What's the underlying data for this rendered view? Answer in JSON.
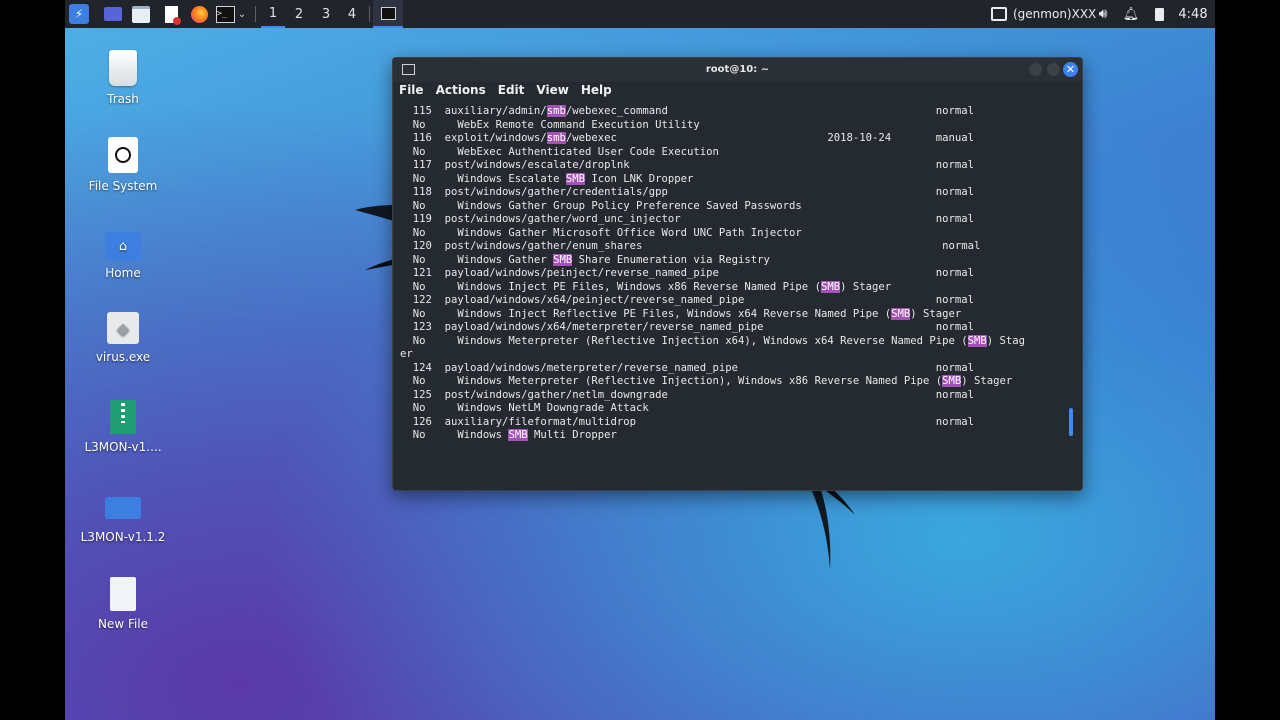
{
  "taskbar": {
    "workspaces": [
      "1",
      "2",
      "3",
      "4"
    ],
    "network_label": "(genmon)XXX",
    "clock": "4:48"
  },
  "desktop": {
    "icons": [
      {
        "label": "Trash",
        "icon": "trash-icon"
      },
      {
        "label": "File System",
        "icon": "drive-icon"
      },
      {
        "label": "Home",
        "icon": "home-folder-icon"
      },
      {
        "label": "virus.exe",
        "icon": "executable-icon"
      },
      {
        "label": "L3MON-v1....",
        "icon": "archive-icon"
      },
      {
        "label": "L3MON-v1.1.2",
        "icon": "folder-icon"
      },
      {
        "label": "New File",
        "icon": "text-file-icon"
      }
    ]
  },
  "terminal": {
    "title": "root@10: ~",
    "menu": [
      "File",
      "Actions",
      "Edit",
      "View",
      "Help"
    ],
    "lines": [
      "  115  auxiliary/admin/smb/webexec_command                                          normal",
      "  No     WebEx Remote Command Execution Utility",
      "  116  exploit/windows/smb/webexec                                 2018-10-24       manual",
      "  No     WebExec Authenticated User Code Execution",
      "  117  post/windows/escalate/droplnk                                                normal",
      "  No     Windows Escalate SMB Icon LNK Dropper",
      "  118  post/windows/gather/credentials/gpp                                          normal",
      "  No     Windows Gather Group Policy Preference Saved Passwords",
      "  119  post/windows/gather/word_unc_injector                                        normal",
      "  No     Windows Gather Microsoft Office Word UNC Path Injector",
      "  120  post/windows/gather/enum_shares                                               normal",
      "  No     Windows Gather SMB Share Enumeration via Registry",
      "  121  payload/windows/peinject/reverse_named_pipe                                  normal",
      "  No     Windows Inject PE Files, Windows x86 Reverse Named Pipe (SMB) Stager",
      "  122  payload/windows/x64/peinject/reverse_named_pipe                              normal",
      "  No     Windows Inject Reflective PE Files, Windows x64 Reverse Named Pipe (SMB) Stager",
      "  123  payload/windows/x64/meterpreter/reverse_named_pipe                           normal",
      "  No     Windows Meterpreter (Reflective Injection x64), Windows x64 Reverse Named Pipe (SMB) Stag",
      "er",
      "  124  payload/windows/meterpreter/reverse_named_pipe                               normal",
      "  No     Windows Meterpreter (Reflective Injection), Windows x86 Reverse Named Pipe (SMB) Stager",
      "  125  post/windows/gather/netlm_downgrade                                          normal",
      "  No     Windows NetLM Downgrade Attack",
      "  126  auxiliary/fileformat/multidrop                                               normal",
      "  No     Windows SMB Multi Dropper"
    ],
    "highlight_terms": [
      "smb",
      "SMB"
    ],
    "highlight_color": "#a451b8"
  }
}
